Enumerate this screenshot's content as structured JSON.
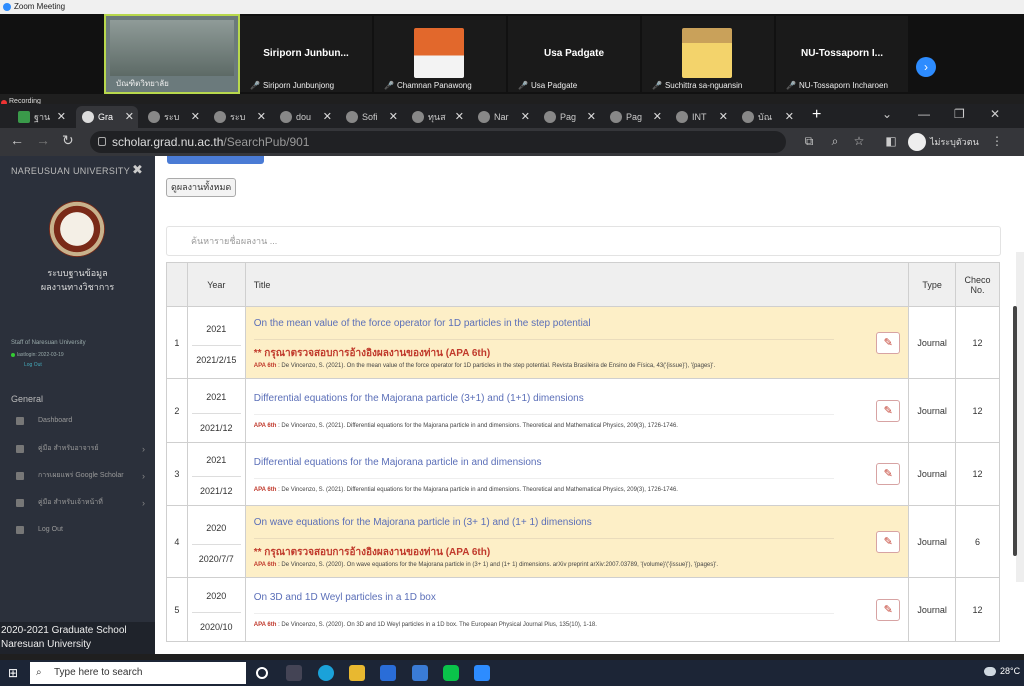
{
  "zoom": {
    "title": "Zoom Meeting",
    "participants": [
      {
        "display": "",
        "label": "บัณฑิตวิทยาลัย"
      },
      {
        "display": "Siriporn  Junbun...",
        "label": "Siriporn Junbunjong"
      },
      {
        "display": "",
        "label": "Chamnan Panawong"
      },
      {
        "display": "Usa Padgate",
        "label": "Usa Padgate"
      },
      {
        "display": "",
        "label": "Suchittra sa-nguansin"
      },
      {
        "display": "NU-Tossaporn I...",
        "label": "NU-Tossaporn Incharoen"
      }
    ],
    "recording": "Recording"
  },
  "browser": {
    "tabs": [
      "ฐาน",
      "Gra",
      "ระบ",
      "ระบ",
      "dou",
      "Sofi",
      "ทุนส",
      "Nar",
      "Pag",
      "Pag",
      "INT",
      "บัณ"
    ],
    "url_host": "scholar.grad.nu.ac.th",
    "url_path": "/SearchPub/901",
    "profile": "ไม่ระบุตัวตน"
  },
  "sidebar": {
    "header": "NAREUSUAN UNIVERSITY",
    "system_line1": "ระบบฐานข้อมูล",
    "system_line2": "ผลงานทางวิชาการ",
    "staff": "Staff of Naresuan University",
    "last_login": "lastlogin: 2022-03-19",
    "logout_small": "Log Out",
    "general": "General",
    "menu": [
      {
        "label": "Dashboard",
        "chevron": false
      },
      {
        "label": "คู่มือ สำหรับอาจารย์",
        "chevron": true
      },
      {
        "label": "การเผยแพร่ Google Scholar",
        "chevron": true
      },
      {
        "label": "คู่มือ สำหรับเจ้าหน้าที่",
        "chevron": true
      },
      {
        "label": "Log Out",
        "chevron": false
      }
    ],
    "footer_line1": "2020-2021 Graduate School",
    "footer_line2": "Naresuan University"
  },
  "main": {
    "view_all": "ดูผลงานทั้งหมด",
    "search_placeholder": "ค้นหารายชื่อผลงาน ...",
    "columns": {
      "year": "Year",
      "title": "Title",
      "type": "Type",
      "checo1": "Checo",
      "checo2": "No."
    },
    "rows": [
      {
        "idx": "1",
        "year": "2021",
        "date": "2021/2/15",
        "highlight": true,
        "title": "On the mean value of the force operator for 1D particles in the step potential",
        "warning": "** กรุณาตรวจสอบการอ้างอิงผลงานของท่าน (APA 6th)",
        "apa_label": "APA 6th",
        "apa": " : De Vincenzo, S. (2021). On the mean value of the force operator for 1D particles in the step potential. Revista Brasileira de Ensino de Física, 43('{issue}'), '{pages}'.",
        "type": "Journal",
        "checo": "12"
      },
      {
        "idx": "2",
        "year": "2021",
        "date": "2021/12",
        "highlight": false,
        "title": "Differential equations for the Majorana particle (3+1) and (1+1) dimensions",
        "warning": "",
        "apa_label": "APA 6th",
        "apa": " : De Vincenzo, S. (2021). Differential equations for the Majorana particle in and dimensions. Theoretical and Mathematical Physics, 209(3), 1726-1746.",
        "type": "Journal",
        "checo": "12"
      },
      {
        "idx": "3",
        "year": "2021",
        "date": "2021/12",
        "highlight": false,
        "title": "Differential equations for the Majorana particle in and dimensions",
        "warning": "",
        "apa_label": "APA 6th",
        "apa": " : De Vincenzo, S. (2021). Differential equations for the Majorana particle in and dimensions. Theoretical and Mathematical Physics, 209(3), 1726-1746.",
        "type": "Journal",
        "checo": "12"
      },
      {
        "idx": "4",
        "year": "2020",
        "date": "2020/7/7",
        "highlight": true,
        "title": "On wave equations for the Majorana particle in (3+ 1) and (1+ 1) dimensions",
        "warning": "** กรุณาตรวจสอบการอ้างอิงผลงานของท่าน (APA 6th)",
        "apa_label": "APA 6th",
        "apa": " : De Vincenzo, S. (2020). On wave equations for the Majorana particle in (3+ 1) and (1+ 1) dimensions. arXiv preprint arXiv:2007.03789, '{volume}'('{issue}'), '{pages}'.",
        "type": "Journal",
        "checo": "6"
      },
      {
        "idx": "5",
        "year": "2020",
        "date": "2020/10",
        "highlight": false,
        "title": "On 3D and 1D Weyl particles in a 1D box",
        "warning": "",
        "apa_label": "APA 6th",
        "apa": " : De Vincenzo, S. (2020). On 3D and 1D Weyl particles in a 1D box. The European Physical Journal Plus, 135(10), 1-18.",
        "type": "Journal",
        "checo": "12"
      }
    ]
  },
  "taskbar": {
    "search_placeholder": "Type here to search",
    "temperature": "28°C"
  }
}
